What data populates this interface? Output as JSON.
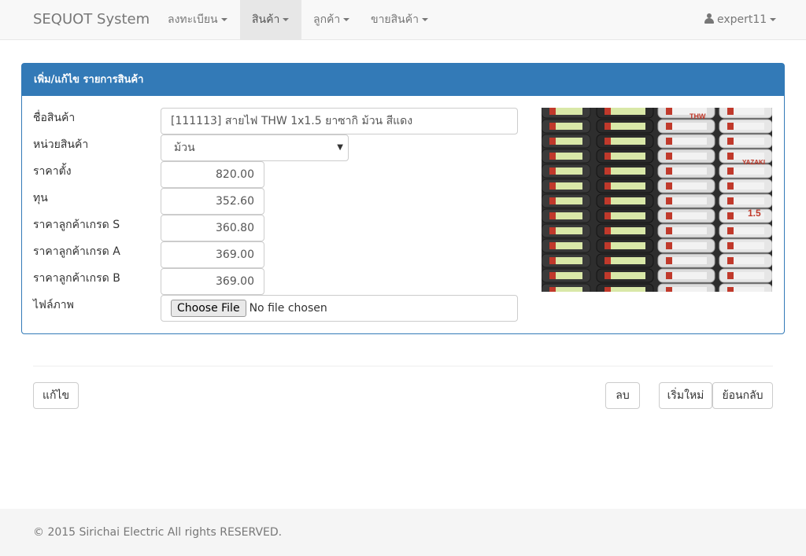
{
  "navbar": {
    "brand": "SEQUOT System",
    "menus": [
      {
        "label": "ลงทะเบียน"
      },
      {
        "label": "สินค้า"
      },
      {
        "label": "ลูกค้า"
      },
      {
        "label": "ขายสินค้า"
      }
    ],
    "active_menu": "สินค้า",
    "user": "expert11"
  },
  "panel": {
    "title": "เพิ่ม/แก้ไข รายการสินค้า"
  },
  "form": {
    "product_name": {
      "label": "ชื่อสินค้า",
      "value": "[111113] สายไฟ THW 1x1.5 ยาซากิ ม้วน สีแดง"
    },
    "unit": {
      "label": "หน่วยสินค้า",
      "value": "ม้วน"
    },
    "list_price": {
      "label": "ราคาตั้ง",
      "value": "820.00"
    },
    "cost": {
      "label": "ทุน",
      "value": "352.60"
    },
    "price_s": {
      "label": "ราคาลูกค้าเกรด S",
      "value": "360.80"
    },
    "price_a": {
      "label": "ราคาลูกค้าเกรด A",
      "value": "369.00"
    },
    "price_b": {
      "label": "ราคาลูกค้าเกรด B",
      "value": "369.00"
    },
    "image_file": {
      "label": "ไฟล์ภาพ",
      "button": "Choose File",
      "status": "No file chosen"
    }
  },
  "product_image": {
    "roll_brand_text": "YAZAKI",
    "roll_size_text": "1.5",
    "roll_type_text": "THW"
  },
  "actions": {
    "edit": "แก้ไข",
    "delete": "ลบ",
    "reset": "เริ่มใหม่",
    "back": "ย้อนกลับ"
  },
  "footer": {
    "copyright": "© 2015 Sirichai Electric All rights RESERVED."
  },
  "colors": {
    "primary": "#337ab7",
    "navbar_bg": "#f8f8f8",
    "footer_bg": "#f5f5f5"
  }
}
